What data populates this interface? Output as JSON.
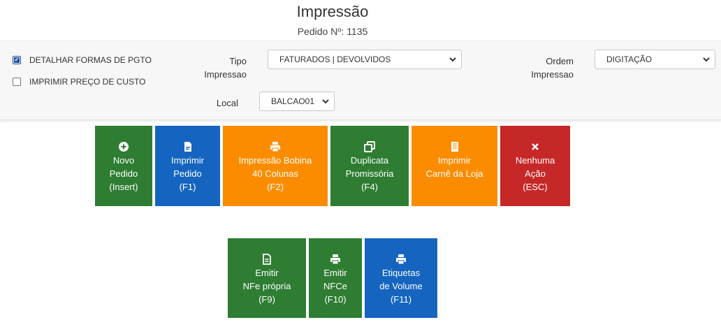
{
  "header": {
    "title": "Impressão",
    "subtitle": "Pedido Nº: 1135"
  },
  "options": {
    "detalhar": {
      "label": "DETALHAR FORMAS DE PGTO",
      "checked": true
    },
    "custo": {
      "label": "IMPRIMIR PREÇO DE CUSTO",
      "checked": false
    },
    "tipo": {
      "label_line1": "Tipo",
      "label_line2": "Impressao",
      "value": "FATURADOS | DEVOLVIDOS"
    },
    "ordem": {
      "label_line1": "Ordem",
      "label_line2": "Impressao",
      "value": "DIGITAÇÃO"
    },
    "local": {
      "label": "Local",
      "value": "BALCAO01"
    }
  },
  "buttons": {
    "novo": {
      "l1": "Novo",
      "l2": "Pedido",
      "l3": "(Insert)",
      "icon": "plus-circle-icon"
    },
    "imprimir": {
      "l1": "Imprimir",
      "l2": "Pedido",
      "l3": "(F1)",
      "icon": "pdf-file-icon"
    },
    "bobina": {
      "l1": "Impressão Bobina",
      "l2": "40 Colunas",
      "l3": "(F2)",
      "icon": "printer-icon"
    },
    "duplicata": {
      "l1": "Duplicata",
      "l2": "Promissória",
      "l3": "(F4)",
      "icon": "copy-icon"
    },
    "carne": {
      "l1": "Imprimir",
      "l2": "Carnê da Loja",
      "icon": "receipt-icon"
    },
    "nenhuma": {
      "l1": "Nenhuma",
      "l2": "Ação",
      "l3": "(ESC)",
      "icon": "close-icon"
    },
    "nfe": {
      "l1": "Emitir",
      "l2": "NFe própria",
      "l3": "(F9)",
      "icon": "document-icon"
    },
    "nfce": {
      "l1": "Emitir",
      "l2": "NFCe",
      "l3": "(F10)",
      "icon": "printer-icon"
    },
    "etiquetas": {
      "l1": "Etiquetas",
      "l2": "de Volume",
      "l3": "(F11)",
      "icon": "printer-icon"
    }
  },
  "colors": {
    "green": "#2e7d32",
    "blue": "#1565c0",
    "orange": "#fb8c00",
    "red": "#c62828"
  }
}
